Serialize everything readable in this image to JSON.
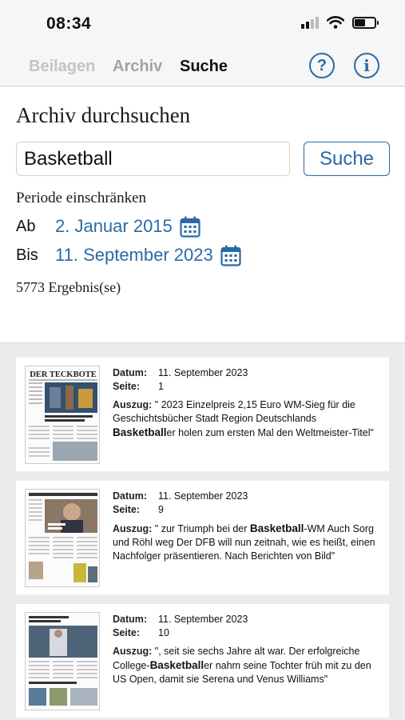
{
  "status": {
    "time": "08:34"
  },
  "tabs": {
    "beilagen": "Beilagen",
    "archiv": "Archiv",
    "suche": "Suche"
  },
  "header": {
    "help_glyph": "?",
    "info_glyph": "i",
    "help_icon": "question-circle-icon",
    "info_icon": "info-circle-icon"
  },
  "search": {
    "title": "Archiv durchsuchen",
    "query": "Basketball",
    "button_label": "Suche",
    "period_label": "Periode einschränken",
    "from_prefix": "Ab",
    "from_date": "2. Januar 2015",
    "to_prefix": "Bis",
    "to_date": "11. September 2023",
    "result_count": "5773 Ergebnis(se)"
  },
  "labels": {
    "datum": "Datum:",
    "seite": "Seite:",
    "auszug": "Auszug:"
  },
  "results": [
    {
      "date": "11. September 2023",
      "page": "1",
      "excerpt_pre": " \" 2023  Einzelpreis 2,15 Euro  WM-Sieg für die Geschichtsbücher  Stadt   Region  Deutschlands ",
      "excerpt_match": "Basketball",
      "excerpt_post": "er holen zum ersten Mal den Weltmeister-Titel\"",
      "thumb_masthead": "DER TECKBOTE"
    },
    {
      "date": "11. September 2023",
      "page": "9",
      "excerpt_pre": " \" zur Triumph bei der ",
      "excerpt_match": "Basketball",
      "excerpt_post": "-WM  Auch Sorg und Röhl weg Der DFB will nun zeitnah, wie es heißt, einen Nachfolger präsentieren. Nach Berichten von Bild\"",
      "thumb_masthead": ""
    },
    {
      "date": "11. September 2023",
      "page": "10",
      "excerpt_pre": " \", seit sie sechs Jahre alt war. Der erfolgreiche College-",
      "excerpt_match": "Basketball",
      "excerpt_post": "er nahm seine Tochter früh mit zu den US Open, damit sie Serena und Venus Williams\"",
      "thumb_masthead": ""
    }
  ],
  "colors": {
    "accent": "#2a6aa6",
    "background": "#ebebeb"
  }
}
